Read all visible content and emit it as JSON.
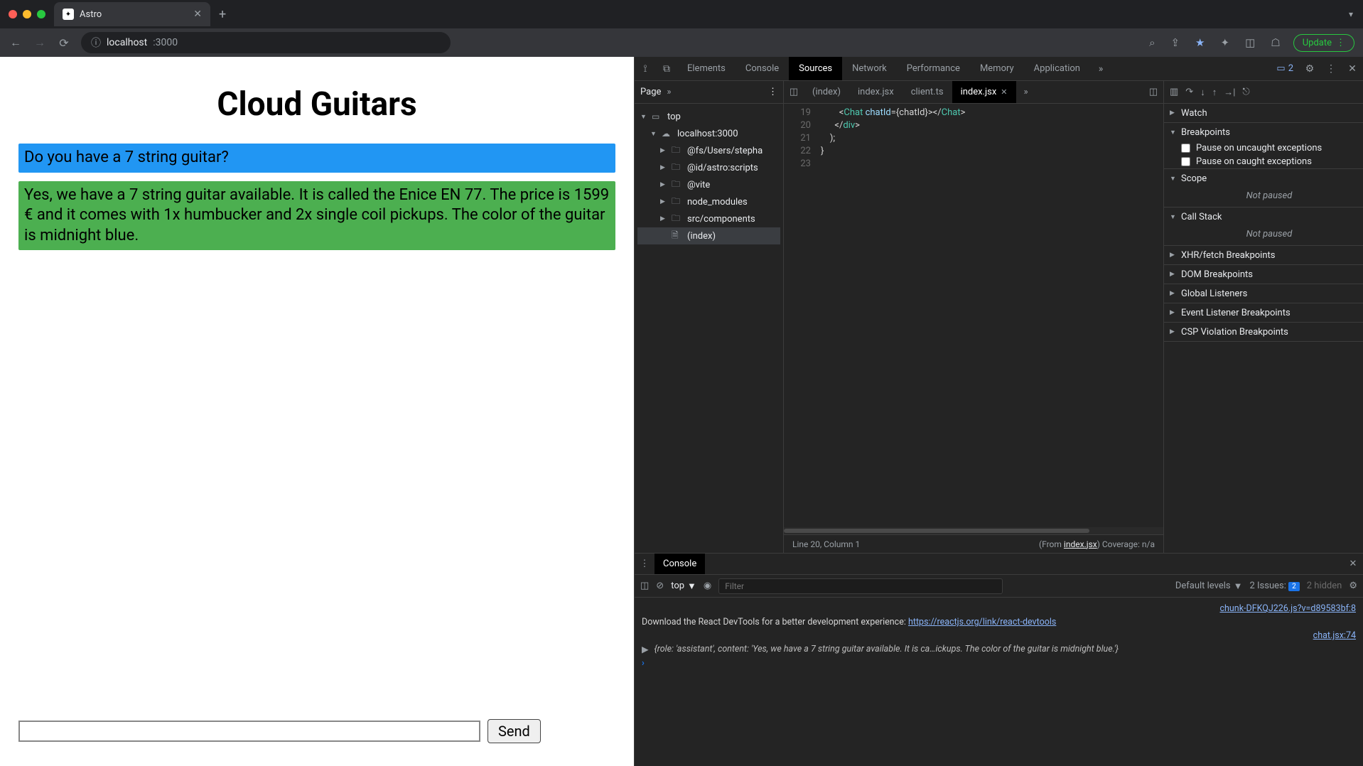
{
  "browser": {
    "tab_title": "Astro",
    "url_host": "localhost",
    "url_port": ":3000",
    "update_label": "Update"
  },
  "page": {
    "title": "Cloud Guitars",
    "messages": [
      {
        "role": "user",
        "text": "Do you have a 7 string guitar?"
      },
      {
        "role": "assistant",
        "text": "Yes, we have a 7 string guitar available. It is called the Enice EN 77. The price is 1599 € and it comes with 1x humbucker and 2x single coil pickups. The color of the guitar is midnight blue."
      }
    ],
    "send_label": "Send",
    "input_value": ""
  },
  "devtools": {
    "tabs": [
      "Elements",
      "Console",
      "Sources",
      "Network",
      "Performance",
      "Memory",
      "Application"
    ],
    "active_tab": "Sources",
    "issue_count": "2",
    "sources": {
      "nav_tab": "Page",
      "tree": {
        "top": "top",
        "origin": "localhost:3000",
        "folders": [
          "@fs/Users/stepha",
          "@id/astro:scripts",
          "@vite",
          "node_modules",
          "src/components"
        ],
        "index": "(index)"
      },
      "editor_tabs": [
        "(index)",
        "index.jsx",
        "client.ts",
        "index.jsx"
      ],
      "active_editor_tab": 3,
      "gutter_start": 19,
      "code_lines": [
        {
          "indent": "        ",
          "parts": [
            {
              "t": "<",
              "c": "tok-brace"
            },
            {
              "t": "Chat",
              "c": "tok-comp"
            },
            {
              "t": " chatId",
              "c": "tok-attr"
            },
            {
              "t": "=",
              "c": "tok-brace"
            },
            {
              "t": "{chatId}",
              "c": "tok-brace"
            },
            {
              "t": "><",
              "c": "tok-brace"
            },
            {
              "t": "/",
              "c": "tok-brace"
            },
            {
              "t": "Chat",
              "c": "tok-comp"
            },
            {
              "t": ">",
              "c": "tok-brace"
            }
          ]
        },
        {
          "indent": "      ",
          "parts": [
            {
              "t": "</",
              "c": "tok-brace"
            },
            {
              "t": "div",
              "c": "tok-tag"
            },
            {
              "t": ">",
              "c": "tok-brace"
            }
          ]
        },
        {
          "indent": "    ",
          "parts": [
            {
              "t": ");",
              "c": "tok-brace"
            }
          ]
        },
        {
          "indent": "",
          "parts": [
            {
              "t": "}",
              "c": "tok-brace"
            }
          ]
        },
        {
          "indent": "",
          "parts": []
        }
      ],
      "status_left": "Line 20, Column 1",
      "status_from": "(From ",
      "status_link": "index.jsx",
      "status_after": ") Coverage: n/a"
    },
    "sidebar": {
      "sections": {
        "watch": "Watch",
        "breakpoints": "Breakpoints",
        "bp_uncaught": "Pause on uncaught exceptions",
        "bp_caught": "Pause on caught exceptions",
        "scope": "Scope",
        "scope_body": "Not paused",
        "callstack": "Call Stack",
        "callstack_body": "Not paused",
        "xhr": "XHR/fetch Breakpoints",
        "dom": "DOM Breakpoints",
        "global": "Global Listeners",
        "event": "Event Listener Breakpoints",
        "csp": "CSP Violation Breakpoints"
      }
    },
    "console": {
      "tab": "Console",
      "context": "top",
      "filter_placeholder": "Filter",
      "levels": "Default levels",
      "issues_label": "2 Issues:",
      "issues_count": "2",
      "hidden": "2 hidden",
      "lines": {
        "src0": "chunk-DFKQJ226.js?v=d89583bf:8",
        "msg0_pre": "Download the React DevTools for a better development experience: ",
        "msg0_link": "https://reactjs.org/link/react-devtools",
        "src1": "chat.jsx:74",
        "obj": "{role: 'assistant', content: 'Yes, we have a 7 string guitar available. It is ca…ickups. The color of the guitar is midnight blue.'}"
      }
    }
  }
}
